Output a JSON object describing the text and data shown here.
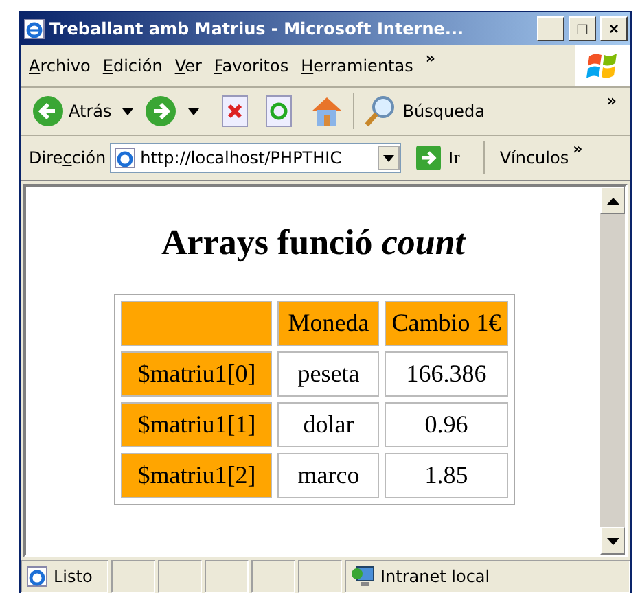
{
  "window": {
    "title": "Treballant amb Matrius - Microsoft Interne..."
  },
  "window_controls": [
    "_",
    "□",
    "×"
  ],
  "menu": [
    {
      "key": "A",
      "post": "rchivo"
    },
    {
      "key": "E",
      "post": "dición"
    },
    {
      "key": "V",
      "post": "er"
    },
    {
      "key": "F",
      "post": "avoritos"
    },
    {
      "key": "H",
      "post": "erramientas"
    }
  ],
  "menu_more": "»",
  "toolbar": {
    "back": "Atrás",
    "search": "Búsqueda",
    "more": "»"
  },
  "address": {
    "label": {
      "pre": "Dire",
      "key": "c",
      "post": "ción"
    },
    "value": "http://localhost/PHPTHIC",
    "go": "Ir",
    "links": "Vínculos",
    "more": "»"
  },
  "page": {
    "heading": "Arrays funció *count*",
    "table": {
      "columns": [
        "",
        "Moneda",
        "Cambio 1€"
      ],
      "rows": [
        {
          "cells": [
            "$matriu1[0]",
            "peseta",
            "166.386"
          ]
        },
        {
          "cells": [
            "$matriu1[1]",
            "dolar",
            "0.96"
          ]
        },
        {
          "cells": [
            "$matriu1[2]",
            "marco",
            "1.85"
          ]
        }
      ]
    }
  },
  "status_bar": {
    "status": "Listo",
    "zone": "Intranet local"
  }
}
